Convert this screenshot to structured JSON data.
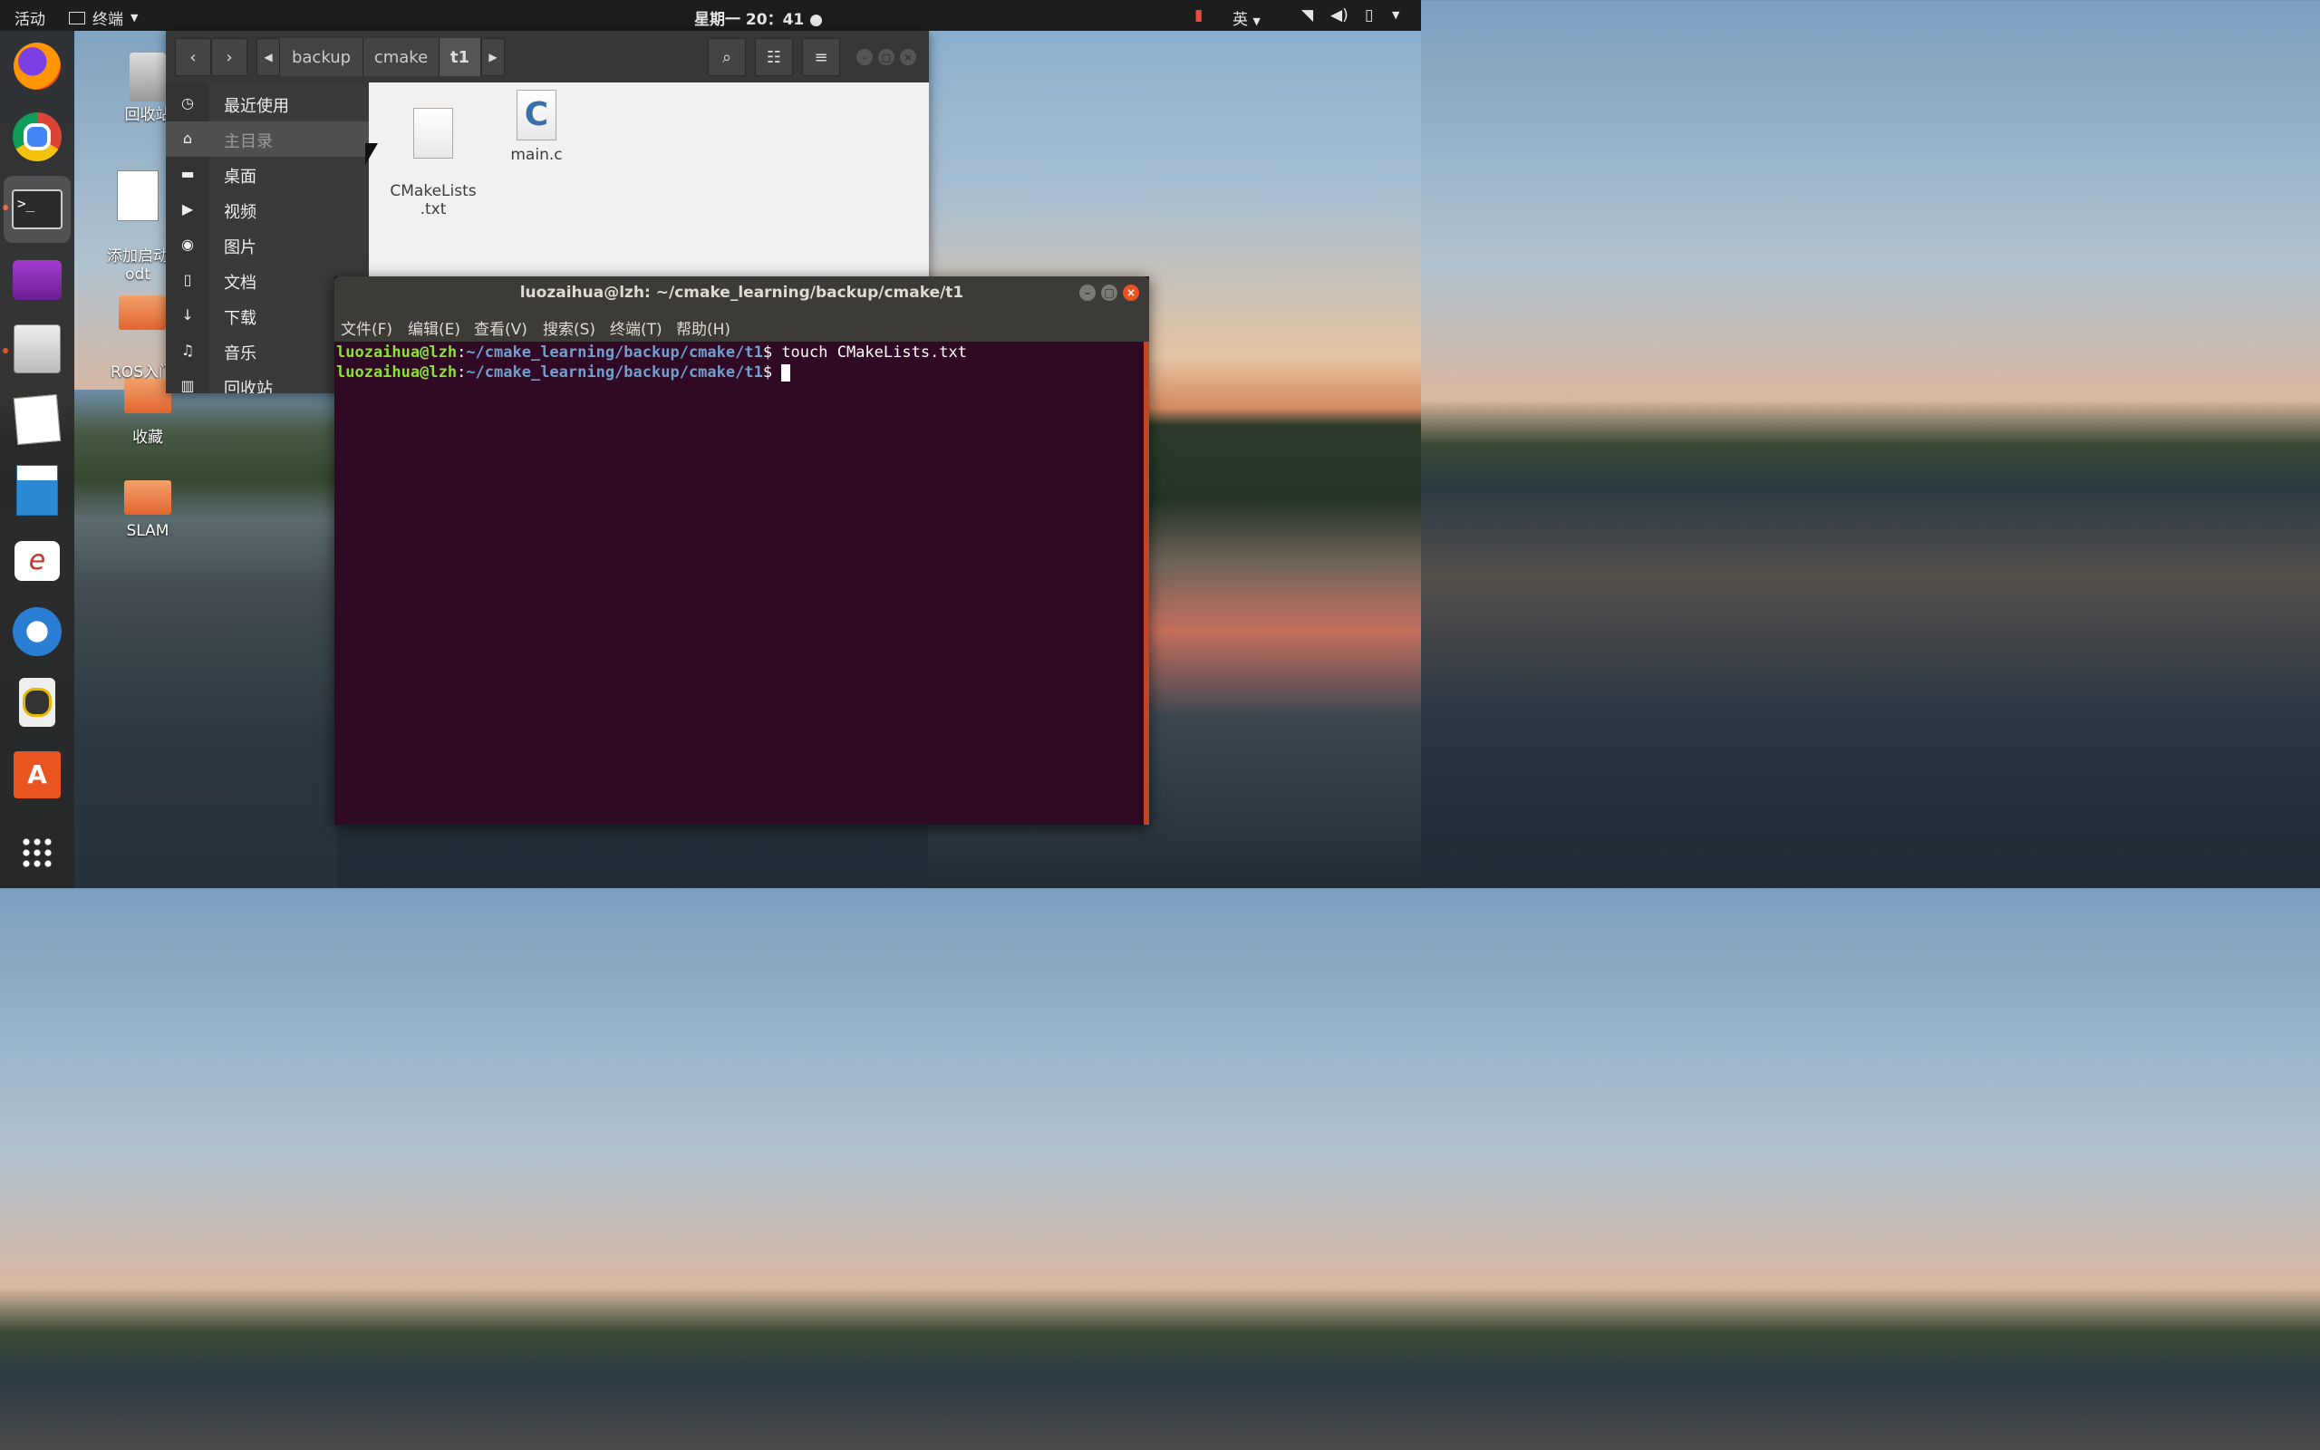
{
  "topbar": {
    "activities": "活动",
    "app_menu": "终端",
    "clock": "星期一 20：41",
    "input_method": "英"
  },
  "desktop": {
    "icons": [
      {
        "label": "回收站"
      },
      {
        "label": "添加启动\nodt"
      },
      {
        "label": "ROS入门\n讲"
      },
      {
        "label": "收藏"
      },
      {
        "label": "SLAM"
      }
    ]
  },
  "file_manager": {
    "breadcrumbs": [
      "backup",
      "cmake",
      "t1"
    ],
    "sidebar": [
      {
        "label": "最近使用",
        "icon": "clock-icon"
      },
      {
        "label": "主目录",
        "icon": "home-icon"
      },
      {
        "label": "桌面",
        "icon": "folder-icon"
      },
      {
        "label": "视频",
        "icon": "video-icon"
      },
      {
        "label": "图片",
        "icon": "camera-icon"
      },
      {
        "label": "文档",
        "icon": "document-icon"
      },
      {
        "label": "下载",
        "icon": "download-icon"
      },
      {
        "label": "音乐",
        "icon": "music-icon"
      },
      {
        "label": "回收站",
        "icon": "trash-icon"
      }
    ],
    "files": [
      {
        "name": "CMakeLists\n.txt",
        "icon": "text-file-icon"
      },
      {
        "name": "main.c",
        "icon": "c-source-file-icon"
      }
    ]
  },
  "terminal": {
    "title": "luozaihua@lzh: ~/cmake_learning/backup/cmake/t1",
    "menu": [
      "文件(F)",
      "编辑(E)",
      "查看(V)",
      "搜索(S)",
      "终端(T)",
      "帮助(H)"
    ],
    "lines": [
      {
        "user": "luozaihua@lzh",
        "path": "~/cmake_learning/backup/cmake/t1",
        "cmd": " touch CMakeLists.txt"
      },
      {
        "user": "luozaihua@lzh",
        "path": "~/cmake_learning/backup/cmake/t1",
        "cmd": " "
      }
    ]
  },
  "colors": {
    "accent": "#e95420",
    "terminal_bg": "#300a24",
    "prompt_user": "#8ae234",
    "prompt_path": "#729fcf"
  }
}
